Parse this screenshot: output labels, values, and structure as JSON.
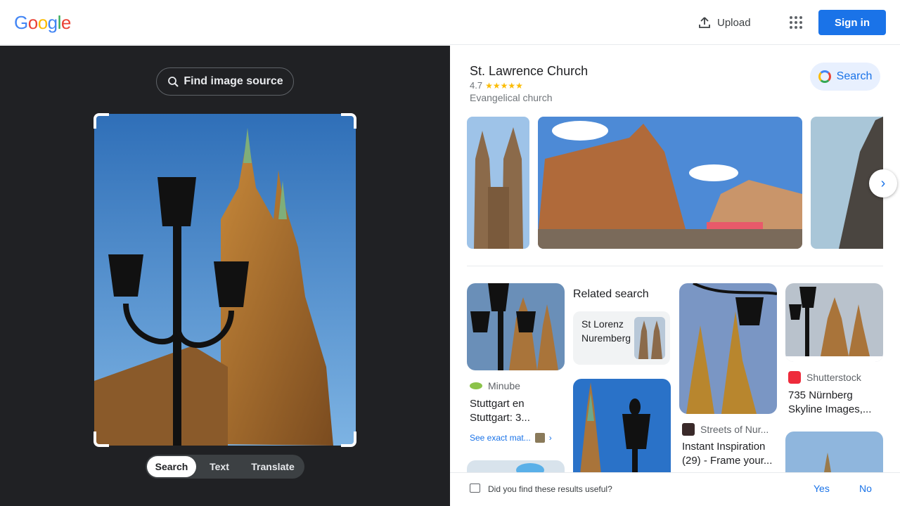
{
  "header": {
    "logo": [
      "G",
      "o",
      "o",
      "g",
      "l",
      "e"
    ],
    "upload_label": "Upload",
    "signin_label": "Sign in"
  },
  "left": {
    "find_source_label": "Find image source",
    "modes": [
      "Search",
      "Text",
      "Translate"
    ]
  },
  "knowledge": {
    "title": "St. Lawrence Church",
    "rating": "4.7",
    "stars": 4.7,
    "subtitle": "Evangelical church",
    "search_label": "Search"
  },
  "results": {
    "related_heading": "Related search",
    "related_item": "St Lorenz Nuremberg",
    "items": [
      {
        "source": "Minube",
        "title": "Stuttgart en Stuttgart: 3..."
      },
      {
        "source": "Streets of Nur...",
        "title": "Instant Inspiration (29) - Frame your..."
      },
      {
        "source": "Shutterstock",
        "title": "735 Nürnberg Skyline Images,..."
      }
    ],
    "see_exact": "See exact mat..."
  },
  "feedback": {
    "question": "Did you find these results useful?",
    "yes": "Yes",
    "no": "No"
  },
  "colors": {
    "accent": "#1a73e8",
    "dark_panel": "#202124"
  }
}
